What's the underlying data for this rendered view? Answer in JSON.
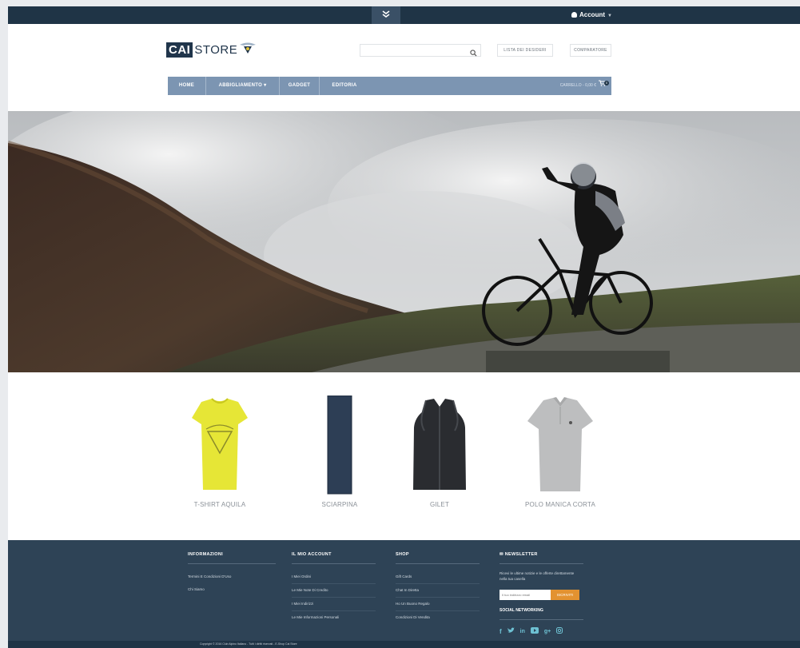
{
  "topbar": {
    "account_label": "Account"
  },
  "header": {
    "logo_cai": "CAI",
    "logo_store": "STORE",
    "search_placeholder": "",
    "wishlist_label": "LISTA DEI DESIDERI",
    "compare_label": "COMPARATORE"
  },
  "nav": {
    "items": [
      "HOME",
      "ABBIGLIAMENTO",
      "GADGET",
      "EDITORIA"
    ],
    "cart_label": "CARRELLO - 0,00 €",
    "cart_count": "0"
  },
  "products": [
    {
      "name": "T-SHIRT AQUILA"
    },
    {
      "name": "SCIARPINA"
    },
    {
      "name": "GILET"
    },
    {
      "name": "POLO MANICA CORTA"
    }
  ],
  "footer": {
    "info": {
      "heading": "INFORMAZIONI",
      "links": [
        "Termini E Condizioni D'Uso",
        "Chi Siamo"
      ]
    },
    "account": {
      "heading": "IL MIO ACCOUNT",
      "links": [
        "I Miei Ordini",
        "Le Mie Note Di Credito",
        "I Miei Indirizzi",
        "Le Mie Informazioni Personali"
      ]
    },
    "shop": {
      "heading": "SHOP",
      "links": [
        "Gift Cards",
        "Chat In Diretta",
        "Ho Un Buono Regalo",
        "Condizioni Di Vendita"
      ]
    },
    "newsletter": {
      "heading": "NEWSLETTER",
      "text": "Ricevi le ultime notizie e le offerte direttamente nella tua casella",
      "email_placeholder": "Il tuo indirizzo email",
      "subscribe_label": "ISCRIVITI",
      "social_heading": "SOCIAL NETWORKING"
    },
    "copyright": "Copyright © 2016 Club Alpino Italiano - Tutti i diritti riservati - E-Shop Cai Store"
  },
  "colors": {
    "topbar": "#1f3446",
    "nav": "#7c95b2",
    "footer": "#2e4356",
    "accent": "#e39230"
  }
}
